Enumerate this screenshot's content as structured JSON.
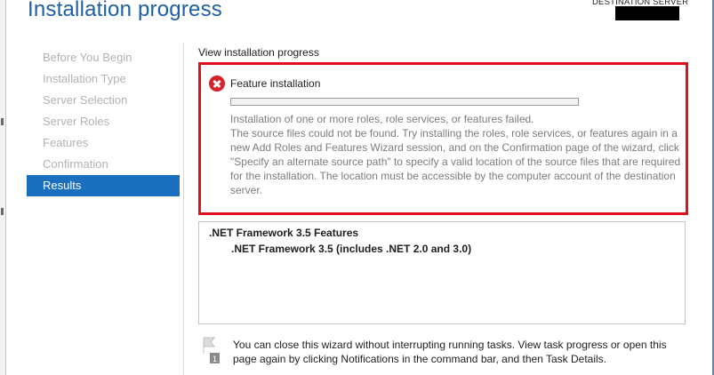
{
  "window": {
    "title": "Installation progress",
    "destination_label": "DESTINATION SERVER"
  },
  "nav": {
    "items": [
      {
        "label": "Before You Begin",
        "active": false
      },
      {
        "label": "Installation Type",
        "active": false
      },
      {
        "label": "Server Selection",
        "active": false
      },
      {
        "label": "Server Roles",
        "active": false
      },
      {
        "label": "Features",
        "active": false
      },
      {
        "label": "Confirmation",
        "active": false
      },
      {
        "label": "Results",
        "active": true
      }
    ]
  },
  "main": {
    "section_title": "View installation progress",
    "result": {
      "status_icon": "error-icon",
      "feature_name": "Feature installation",
      "progress": 0,
      "message_line1": "Installation of one or more roles, role services, or features failed.",
      "message_line2": "The source files could not be found. Try installing the roles, role services, or features again in a new Add Roles and Features Wizard session, and on the Confirmation page of the wizard, click \"Specify an alternate source path\" to specify a valid location of the source files that are required for the installation. The location must be accessible by the computer account of the destination server."
    },
    "features": {
      "parent": ".NET Framework 3.5 Features",
      "child": ".NET Framework 3.5 (includes .NET 2.0 and 3.0)"
    },
    "notification": {
      "icon": "notification-flag-icon",
      "badge": "1",
      "text": "You can close this wizard without interrupting running tasks. View task progress or open this page again by clicking Notifications in the command bar, and then Task Details."
    }
  },
  "colors": {
    "title": "#1f5fa8",
    "nav_active": "#1b6fbf",
    "error_border": "#e0101d",
    "error_icon": "#d7232a"
  }
}
